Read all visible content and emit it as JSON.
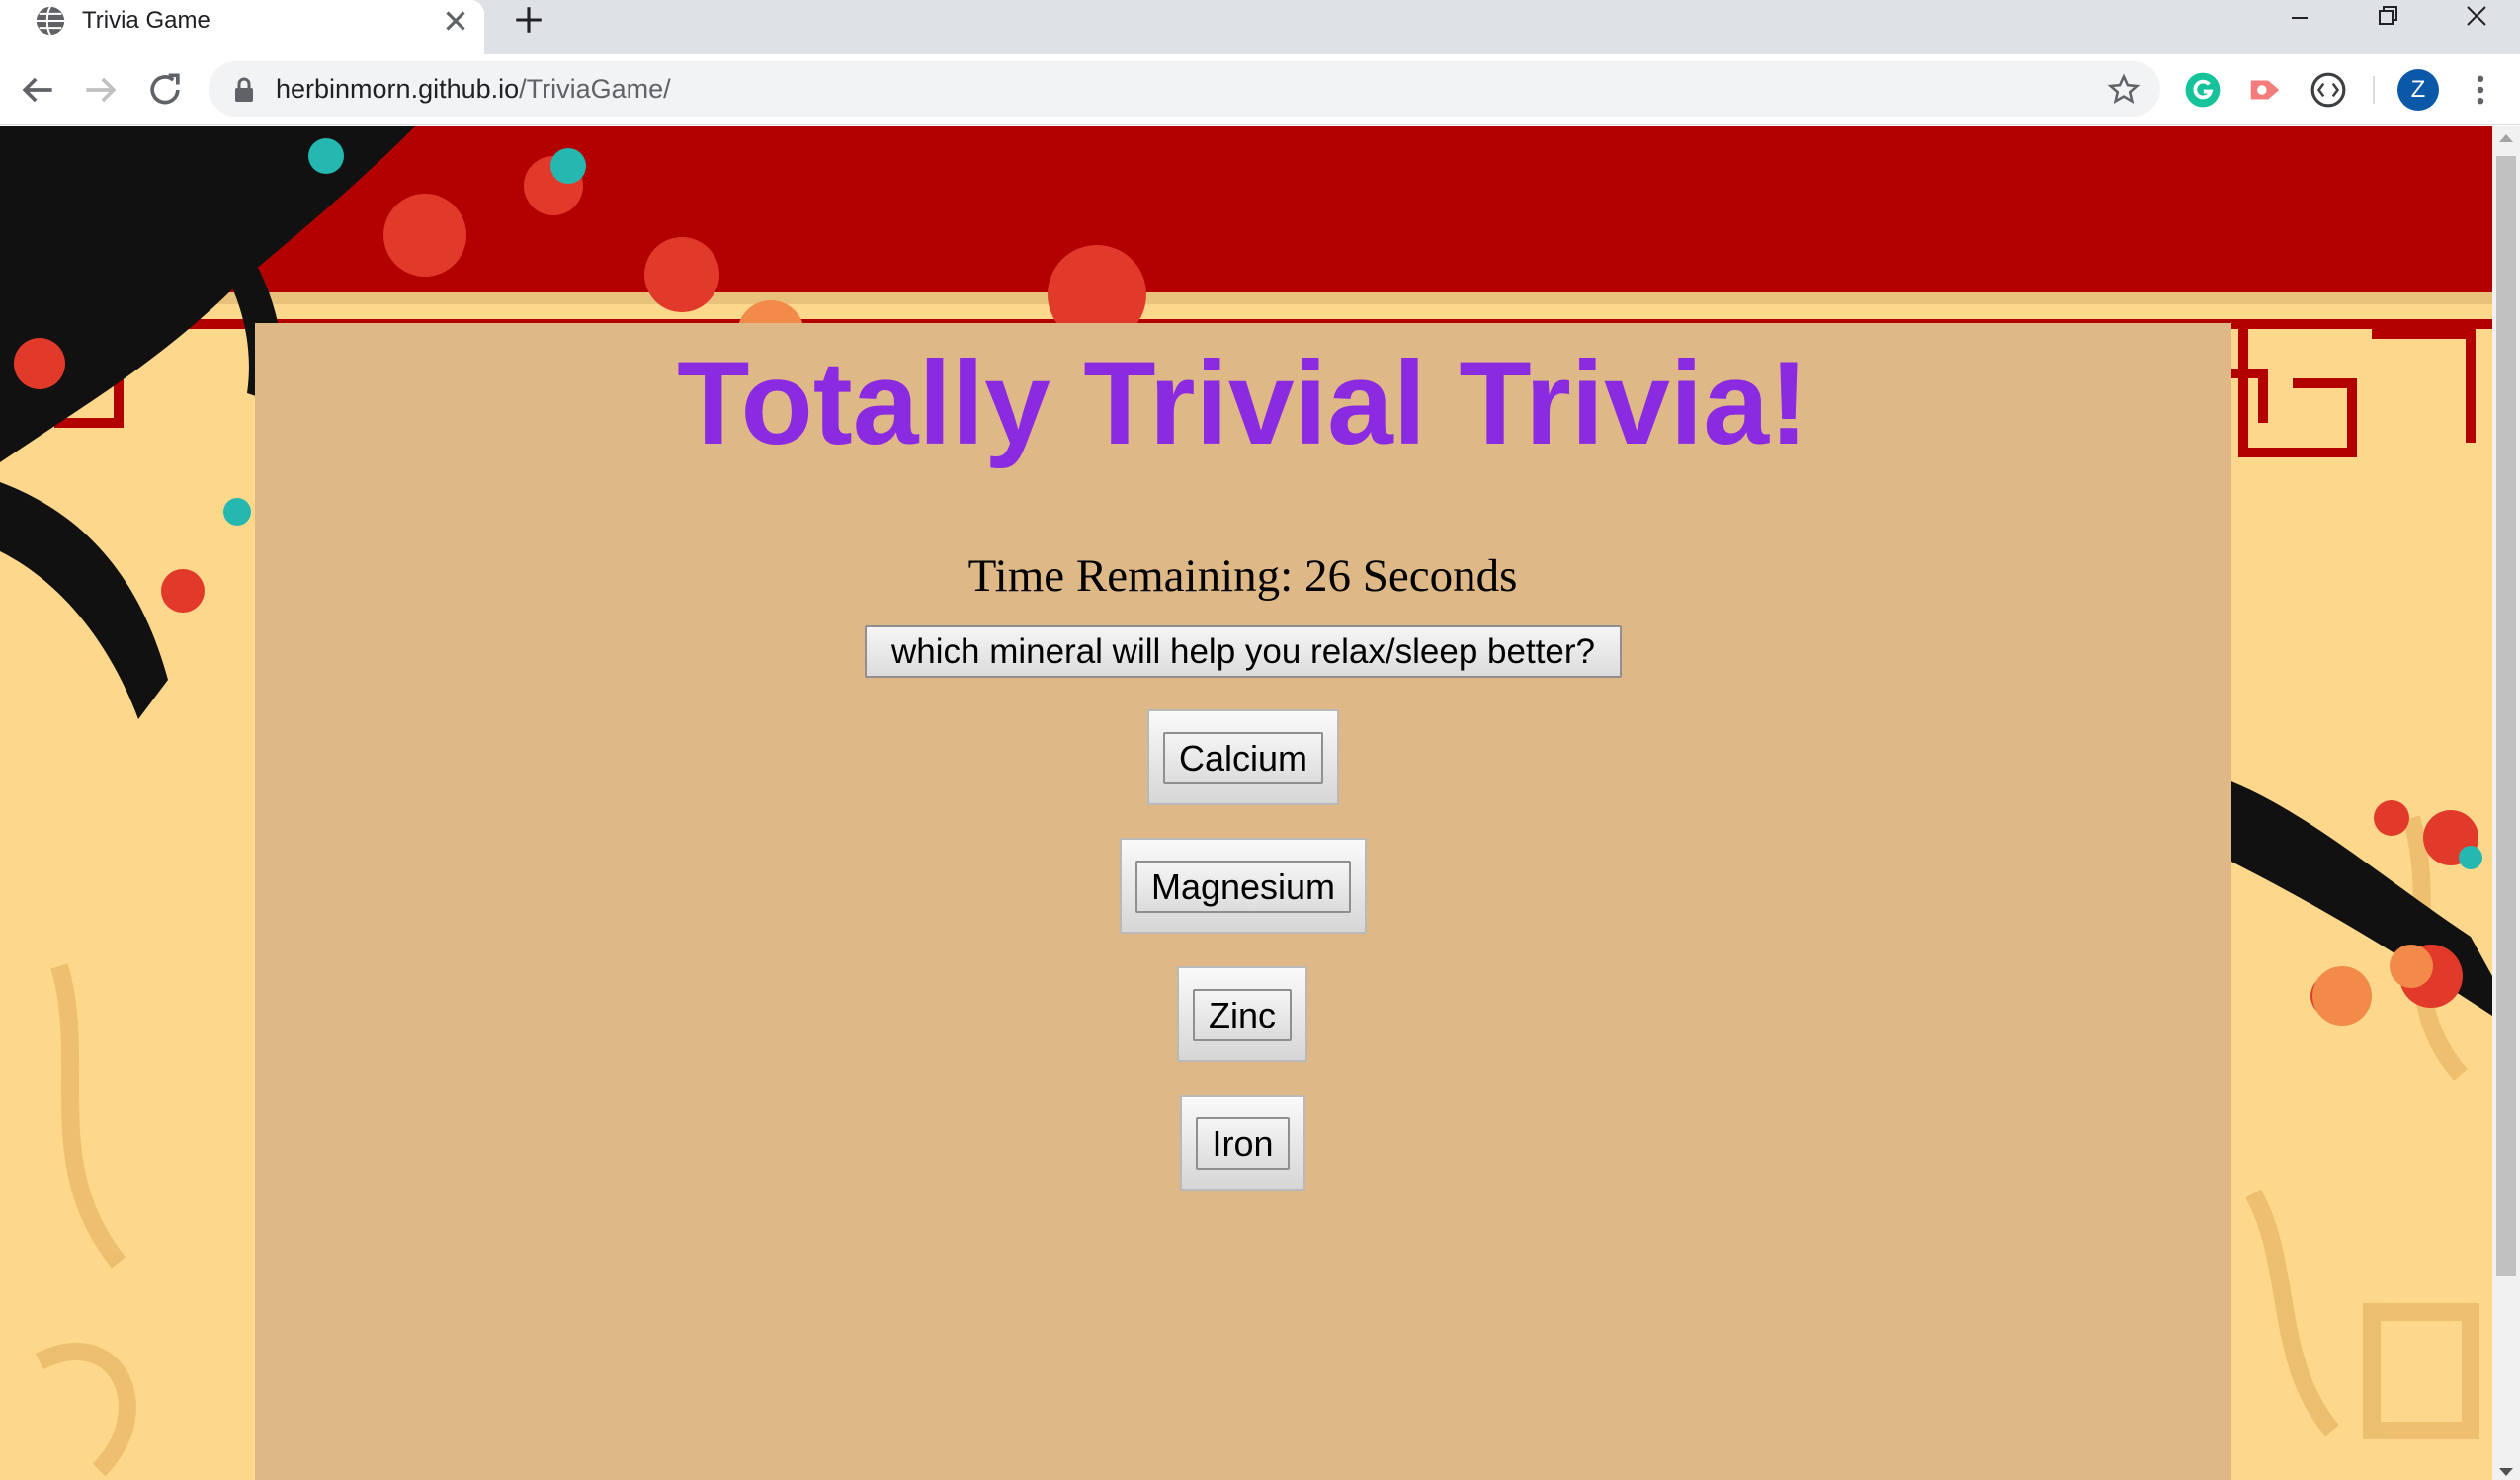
{
  "browser": {
    "tab_title": "Trivia Game",
    "url_host": "herbinmorn.github.io",
    "url_path": "/TriviaGame/",
    "profile_initial": "Z"
  },
  "game": {
    "title": "Totally Trivial Trivia!",
    "timer_text": "Time Remaining: 26 Seconds",
    "question": "which mineral will help you relax/sleep better?",
    "answers": [
      "Calcium",
      "Magnesium",
      "Zinc",
      "Iron"
    ]
  },
  "colors": {
    "title": "#8a2be2",
    "panel": "#deb887",
    "banner_red": "#b30000",
    "background_cream": "#fdd88c"
  }
}
